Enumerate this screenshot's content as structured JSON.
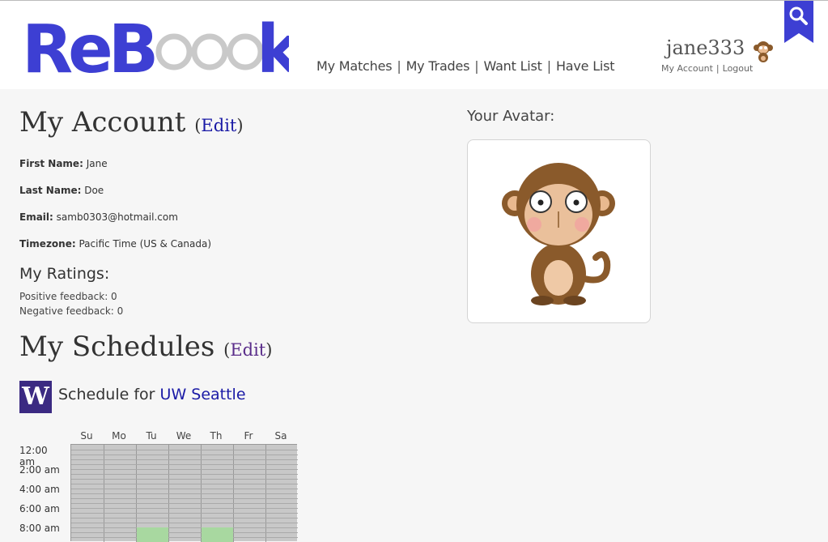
{
  "brand": {
    "logo_text": "ReBook",
    "colors": {
      "primary": "#3d3fd3",
      "gray": "#c8c8c8"
    }
  },
  "nav": {
    "items": [
      {
        "label": "My Matches"
      },
      {
        "label": "My Trades"
      },
      {
        "label": "Want List"
      },
      {
        "label": "Have List"
      }
    ],
    "separator": "|"
  },
  "user": {
    "username": "jane333",
    "my_account_link": "My Account",
    "logout_link": "Logout",
    "separator": "|",
    "avatar_icon": "monkey-icon"
  },
  "search": {
    "icon": "search-icon"
  },
  "account": {
    "title": "My Account",
    "edit_label": "Edit",
    "open_paren": "(",
    "close_paren": ")",
    "first_name_label": "First Name:",
    "first_name": "Jane",
    "last_name_label": "Last Name:",
    "last_name": "Doe",
    "email_label": "Email:",
    "email": "samb0303@hotmail.com",
    "timezone_label": "Timezone:",
    "timezone": "Pacific Time (US & Canada)"
  },
  "ratings": {
    "title": "My Ratings:",
    "positive": "Positive feedback: 0",
    "negative": "Negative feedback: 0"
  },
  "avatar": {
    "label": "Your Avatar:",
    "icon": "monkey-icon"
  },
  "schedules": {
    "title": "My Schedules",
    "edit_label": "Edit",
    "open_paren": "(",
    "close_paren": ")",
    "schedule_prefix": "Schedule for",
    "school": "UW Seattle",
    "school_logo_letter": "W",
    "days": [
      "Su",
      "Mo",
      "Tu",
      "We",
      "Th",
      "Fr",
      "Sa"
    ],
    "times": [
      "12:00 am",
      "2:00 am",
      "4:00 am",
      "6:00 am",
      "8:00 am"
    ],
    "available_days": [
      "Tu",
      "Th"
    ],
    "colors": {
      "grid": "#c8c8c8",
      "available": "#a8d8a0"
    }
  }
}
